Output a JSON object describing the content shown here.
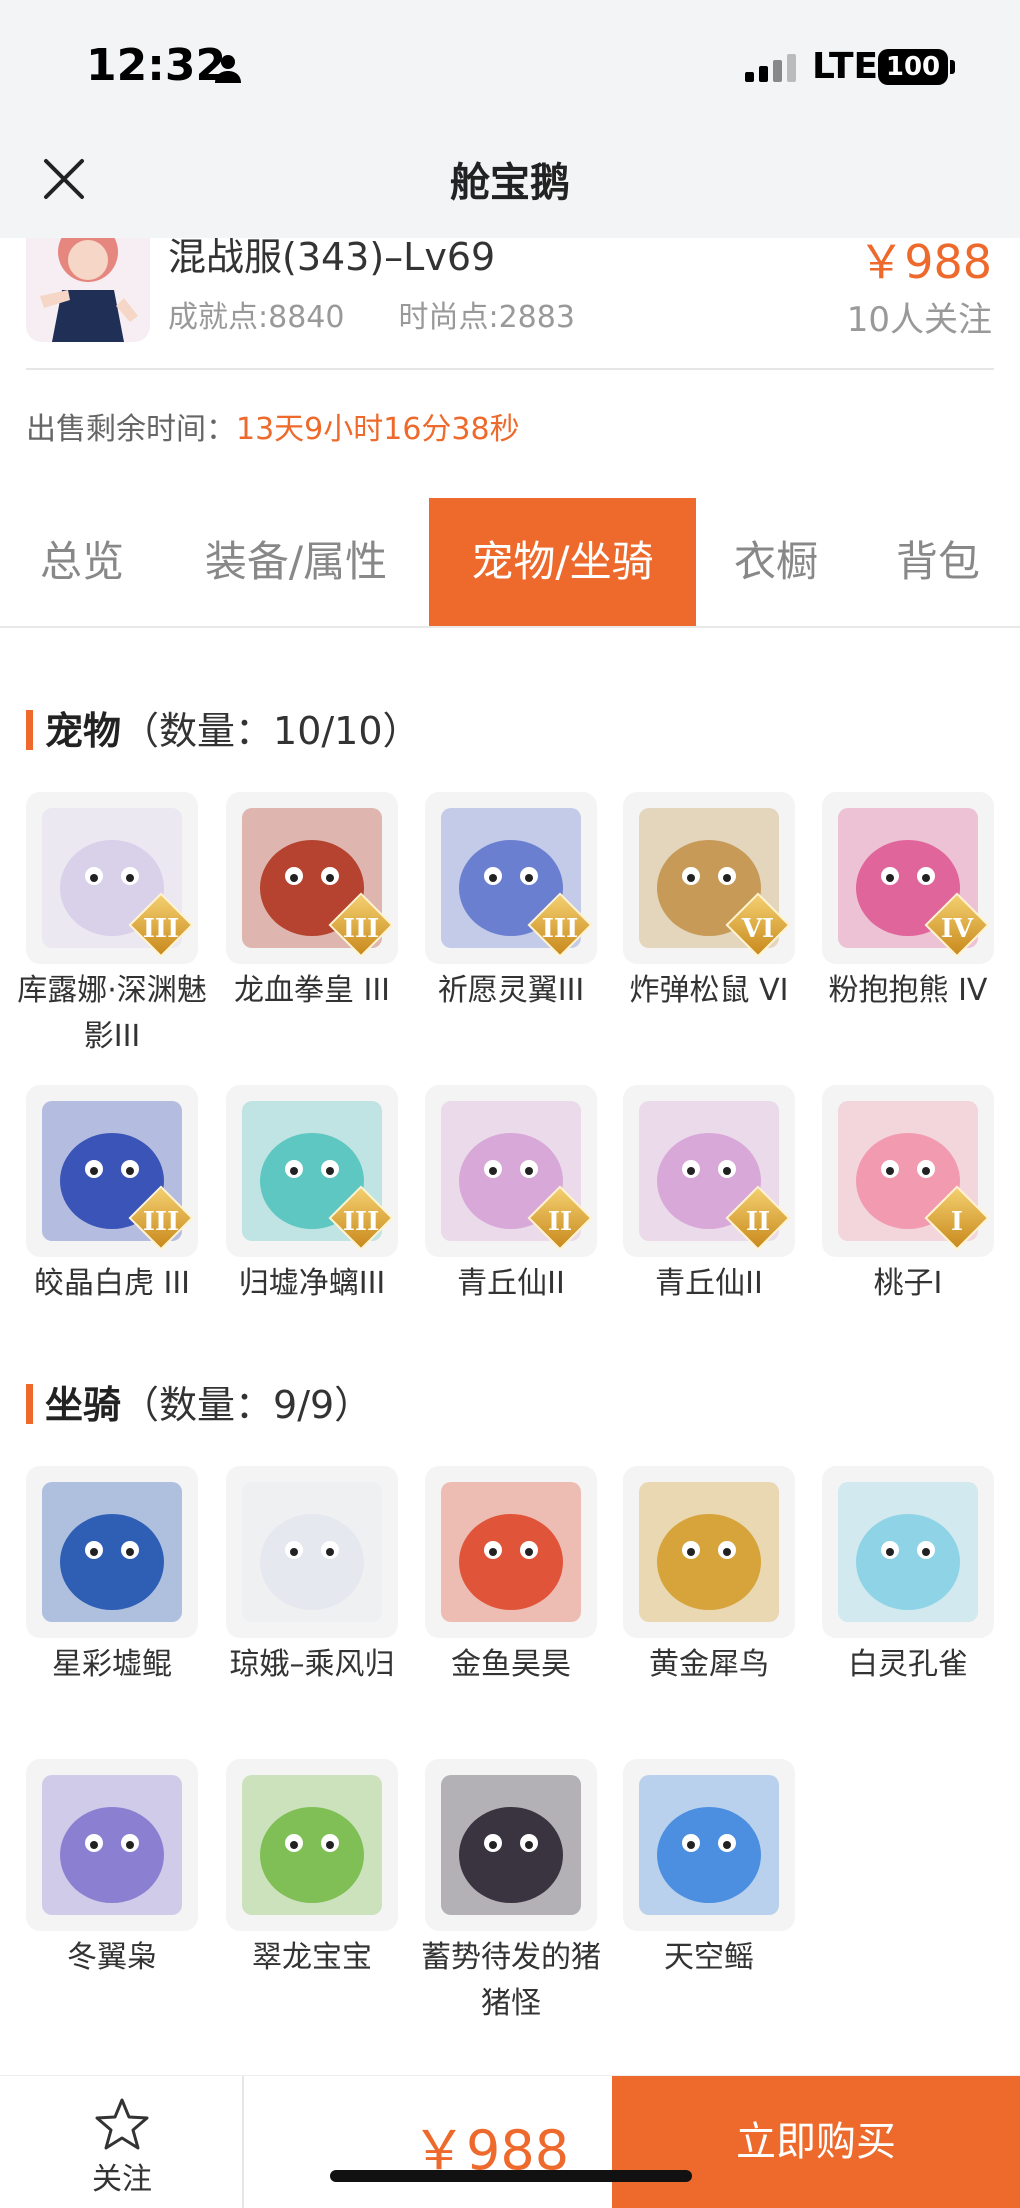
{
  "status_bar": {
    "time": "12:32",
    "network": "LTE",
    "battery": "100"
  },
  "nav": {
    "title": "舱宝鹅"
  },
  "product": {
    "name": "混战服(343)–Lv69",
    "price": "￥988",
    "achievement": "成就点:8840",
    "fashion": "时尚点:2883",
    "followers": "10人关注",
    "sale_label": "出售剩余时间：",
    "countdown": "13天9小时16分38秒"
  },
  "tabs": [
    {
      "label": "总览"
    },
    {
      "label": "装备/属性"
    },
    {
      "label": "宠物/坐骑",
      "active": true
    },
    {
      "label": "衣橱"
    },
    {
      "label": "背包"
    }
  ],
  "pets": {
    "title": "宠物",
    "count": "（数量：10/10）",
    "items": [
      {
        "name": "库露娜·深渊魅影III",
        "rank": "III",
        "color": "#d9d0ea"
      },
      {
        "name": "龙血拳皇 III",
        "rank": "III",
        "color": "#b5432f"
      },
      {
        "name": "祈愿灵翼III",
        "rank": "III",
        "color": "#6a7fd0"
      },
      {
        "name": "炸弹松鼠 VI",
        "rank": "VI",
        "color": "#c79a57"
      },
      {
        "name": "粉抱抱熊 IV",
        "rank": "IV",
        "color": "#e0659a"
      },
      {
        "name": "皎晶白虎 III",
        "rank": "III",
        "color": "#3b54b8"
      },
      {
        "name": "归墟净螭III",
        "rank": "III",
        "color": "#5ec7c2"
      },
      {
        "name": "青丘仙II",
        "rank": "II",
        "color": "#d8a8d8"
      },
      {
        "name": "青丘仙II",
        "rank": "II",
        "color": "#d8a8d8"
      },
      {
        "name": "桃子I",
        "rank": "I",
        "color": "#f29bb0"
      }
    ]
  },
  "mounts": {
    "title": "坐骑",
    "count": "（数量：9/9）",
    "items": [
      {
        "name": "星彩墟鲲",
        "color": "#2f5fb5"
      },
      {
        "name": "琼娥–乘风归",
        "color": "#e6e8ef"
      },
      {
        "name": "金鱼昊昊",
        "color": "#e0553a"
      },
      {
        "name": "黄金犀鸟",
        "color": "#d6a43a"
      },
      {
        "name": "白灵孔雀",
        "color": "#8fd3e6"
      },
      {
        "name": "冬翼枭",
        "color": "#8b7fd1"
      },
      {
        "name": "翠龙宝宝",
        "color": "#7fbf55"
      },
      {
        "name": "蓄势待发的猪猪怪",
        "color": "#3a3340"
      },
      {
        "name": "天空鳐",
        "color": "#4c8fe0"
      }
    ]
  },
  "bottom": {
    "follow": "关注",
    "price": "￥988",
    "buy": "立即购买"
  }
}
